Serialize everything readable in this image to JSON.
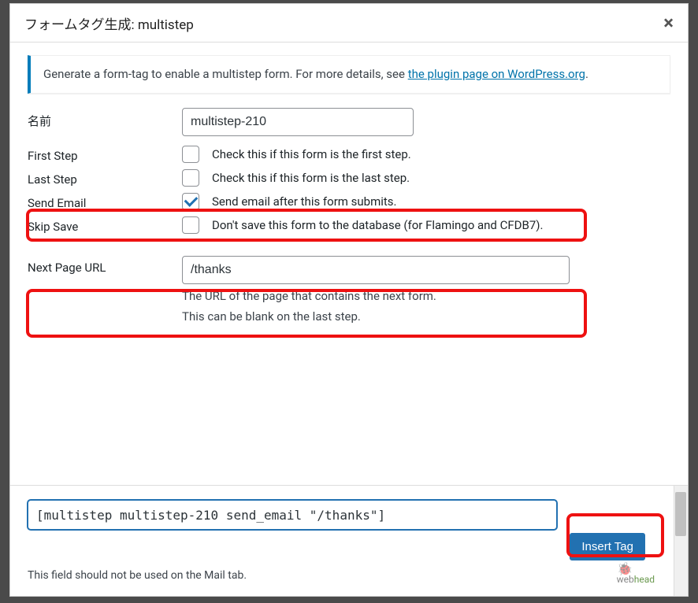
{
  "header": {
    "title": "フォームタグ生成: multistep"
  },
  "info": {
    "prefix": "Generate a form-tag to enable a multistep form. For more details, see ",
    "link_text": "the plugin page on WordPress.org",
    "suffix": "."
  },
  "fields": {
    "name": {
      "label": "名前",
      "value": "multistep-210"
    },
    "first_step": {
      "label": "First Step",
      "desc": "Check this if this form is the first step.",
      "checked": false
    },
    "last_step": {
      "label": "Last Step",
      "desc": "Check this if this form is the last step.",
      "checked": false
    },
    "send_email": {
      "label": "Send Email",
      "desc": "Send email after this form submits.",
      "checked": true
    },
    "skip_save": {
      "label": "Skip Save",
      "desc": "Don't save this form to the database (for Flamingo and CFDB7).",
      "checked": false
    },
    "next_url": {
      "label": "Next Page URL",
      "value": "/thanks",
      "help1": "The URL of the page that contains the next form.",
      "help2": "This can be blank on the last step."
    }
  },
  "footer": {
    "tag_value": "[multistep multistep-210 send_email \"/thanks\"]",
    "insert_label": "Insert Tag",
    "note": "This field should not be used on the Mail tab.",
    "logo1": "web",
    "logo2": "head"
  }
}
